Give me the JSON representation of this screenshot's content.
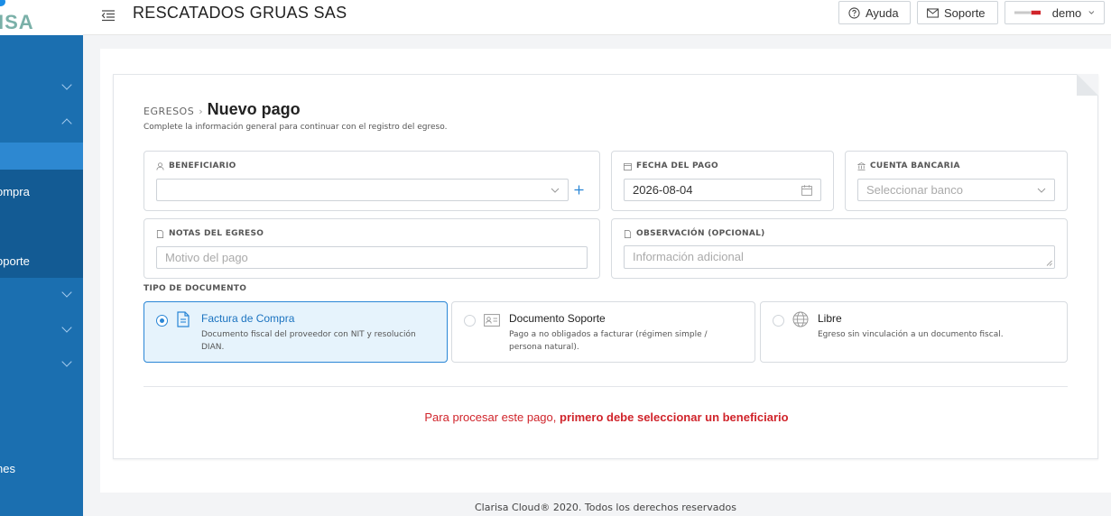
{
  "sidebar": {
    "logo_text": "ISA",
    "items": [
      {
        "label": "ompra"
      },
      {
        "label": "oporte"
      },
      {
        "label": "nes"
      }
    ]
  },
  "topbar": {
    "company": "RESCATADOS GRUAS SAS",
    "help_label": "Ayuda",
    "support_label": "Soporte",
    "user_label": "demo"
  },
  "breadcrumb": {
    "parent": "EGRESOS",
    "separator": "›",
    "title": "Nuevo pago"
  },
  "subtitle": "Complete la información general para continuar con el registro del egreso.",
  "form": {
    "beneficiary": {
      "label": "BENEFICIARIO",
      "value": ""
    },
    "payment_date": {
      "label": "FECHA DEL PAGO",
      "value": "2026-08-04"
    },
    "bank_account": {
      "label": "CUENTA BANCARIA",
      "placeholder": "Seleccionar banco"
    },
    "notes": {
      "label": "NOTAS DEL EGRESO",
      "placeholder": "Motivo del pago"
    },
    "observation": {
      "label": "OBSERVACIÓN (OPCIONAL)",
      "placeholder": "Información adicional"
    }
  },
  "document_type": {
    "label": "TIPO DE DOCUMENTO",
    "options": [
      {
        "title": "Factura de Compra",
        "desc": "Documento fiscal del proveedor con NIT y resolución DIAN.",
        "selected": true
      },
      {
        "title": "Documento Soporte",
        "desc": "Pago a no obligados a facturar (régimen simple / persona natural).",
        "selected": false
      },
      {
        "title": "Libre",
        "desc": "Egreso sin vinculación a un documento fiscal.",
        "selected": false
      }
    ]
  },
  "warning": {
    "prefix": "Para procesar este pago,",
    "emphasis": "primero debe seleccionar un beneficiario"
  },
  "footer": "Clarisa Cloud® 2020. Todos los derechos reservados",
  "colors": {
    "sidebar": "#1b6fb0",
    "accent": "#2a86d6",
    "warning": "#d0242b"
  }
}
